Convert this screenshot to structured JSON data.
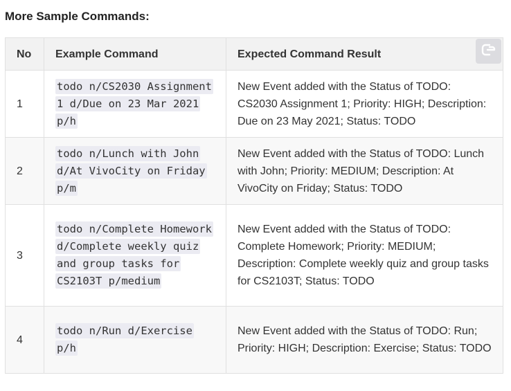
{
  "heading": "More Sample Commands:",
  "table": {
    "headers": [
      "No",
      "Example Command",
      "Expected Command Result"
    ],
    "rows": [
      {
        "no": "1",
        "command": "todo n/CS2030 Assignment 1 d/Due on 23 Mar 2021 p/h",
        "result": "New Event added with the Status of TODO: CS2030 Assignment 1; Priority: HIGH; Description: Due on 23 May 2021; Status: TODO"
      },
      {
        "no": "2",
        "command": "todo n/Lunch with John d/At VivoCity on Friday p/m",
        "result": "New Event added with the Status of TODO: Lunch with John; Priority: MEDIUM; Description: At VivoCity on Friday; Status: TODO"
      },
      {
        "no": "3",
        "command": "todo n/Complete Homework d/Complete weekly quiz and group tasks for CS2103T p/medium",
        "result": "New Event added with the Status of TODO: Complete Homework; Priority: MEDIUM; Description: Complete weekly quiz and group tasks for CS2103T; Status: TODO"
      },
      {
        "no": "4",
        "command": "todo n/Run d/Exercise p/h",
        "result": "New Event added with the Status of TODO: Run; Priority: HIGH; Description: Exercise; Status: TODO"
      }
    ]
  },
  "copy_button": {
    "icon": "copy-icon",
    "color": "#ffffff",
    "background": "#dcdce0"
  }
}
